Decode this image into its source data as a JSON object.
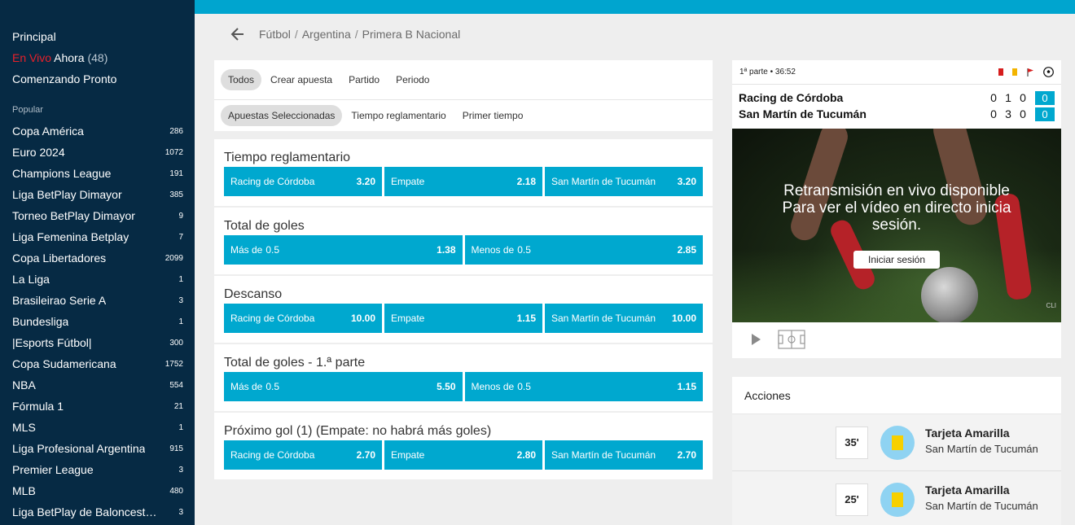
{
  "sidebar": {
    "main_links": [
      "Principal",
      "Comenzando Pronto"
    ],
    "live": {
      "en": "En Vivo",
      "ahora": "Ahora",
      "count": "(48)"
    },
    "section_title": "Popular",
    "items": [
      {
        "label": "Copa América",
        "count": "286"
      },
      {
        "label": "Euro 2024",
        "count": "1072"
      },
      {
        "label": "Champions League",
        "count": "191"
      },
      {
        "label": "Liga BetPlay Dimayor",
        "count": "385"
      },
      {
        "label": "Torneo BetPlay Dimayor",
        "count": "9"
      },
      {
        "label": "Liga Femenina Betplay",
        "count": "7"
      },
      {
        "label": "Copa Libertadores",
        "count": "2099"
      },
      {
        "label": "La Liga",
        "count": "1"
      },
      {
        "label": "Brasileirao Serie A",
        "count": "3"
      },
      {
        "label": "Bundesliga",
        "count": "1"
      },
      {
        "label": "|Esports Fútbol|",
        "count": "300"
      },
      {
        "label": "Copa Sudamericana",
        "count": "1752"
      },
      {
        "label": "NBA",
        "count": "554"
      },
      {
        "label": "Fórmula 1",
        "count": "21"
      },
      {
        "label": "MLS",
        "count": "1"
      },
      {
        "label": "Liga Profesional Argentina",
        "count": "915"
      },
      {
        "label": "Premier League",
        "count": "3"
      },
      {
        "label": "MLB",
        "count": "480"
      },
      {
        "label": "Liga BetPlay de Baloncesto …",
        "count": "3"
      }
    ]
  },
  "breadcrumb": [
    "Fútbol",
    "Argentina",
    "Primera B Nacional"
  ],
  "filters": {
    "row1": [
      "Todos",
      "Crear apuesta",
      "Partido",
      "Periodo"
    ],
    "row2": [
      "Apuestas Seleccionadas",
      "Tiempo reglamentario",
      "Primer tiempo"
    ]
  },
  "markets": [
    {
      "title": "Tiempo reglamentario",
      "odds": [
        {
          "label": "Racing de Córdoba",
          "line": "",
          "price": "3.20"
        },
        {
          "label": "Empate",
          "line": "",
          "price": "2.18"
        },
        {
          "label": "San Martín de Tucumán",
          "line": "",
          "price": "3.20"
        }
      ]
    },
    {
      "title": "Total de goles",
      "odds": [
        {
          "label": "Más de",
          "line": "0.5",
          "price": "1.38"
        },
        {
          "label": "Menos de",
          "line": "0.5",
          "price": "2.85"
        }
      ]
    },
    {
      "title": "Descanso",
      "odds": [
        {
          "label": "Racing de Córdoba",
          "line": "",
          "price": "10.00"
        },
        {
          "label": "Empate",
          "line": "",
          "price": "1.15"
        },
        {
          "label": "San Martín de Tucumán",
          "line": "",
          "price": "10.00"
        }
      ]
    },
    {
      "title": "Total de goles - 1.ª parte",
      "odds": [
        {
          "label": "Más de",
          "line": "0.5",
          "price": "5.50"
        },
        {
          "label": "Menos de",
          "line": "0.5",
          "price": "1.15"
        }
      ]
    },
    {
      "title": "Próximo gol (1) (Empate: no habrá más goles)",
      "odds": [
        {
          "label": "Racing de Córdoba",
          "line": "",
          "price": "2.70"
        },
        {
          "label": "Empate",
          "line": "",
          "price": "2.80"
        },
        {
          "label": "San Martín de Tucumán",
          "line": "",
          "price": "2.70"
        }
      ]
    }
  ],
  "scoreboard": {
    "period": "1ª parte • 36:52",
    "teams": [
      {
        "name": "Racing de Córdoba",
        "scores": [
          "0",
          "1",
          "0"
        ],
        "total": "0"
      },
      {
        "name": "San Martín de Tucumán",
        "scores": [
          "0",
          "3",
          "0"
        ],
        "total": "0"
      }
    ],
    "stream_text": [
      "Retransmisión en vivo disponible",
      "Para ver el vídeo en directo inicia",
      "sesión."
    ],
    "login_label": "Iniciar sesión",
    "watermark": "CLI"
  },
  "actions": {
    "title": "Acciones",
    "events": [
      {
        "minute": "35'",
        "type": "Tarjeta Amarilla",
        "team": "San Martín de Tucumán"
      },
      {
        "minute": "25'",
        "type": "Tarjeta Amarilla",
        "team": "San Martín de Tucumán"
      }
    ]
  },
  "colors": {
    "accent": "#00a8cf",
    "sidebar": "#062a44",
    "live": "#e8202a"
  }
}
